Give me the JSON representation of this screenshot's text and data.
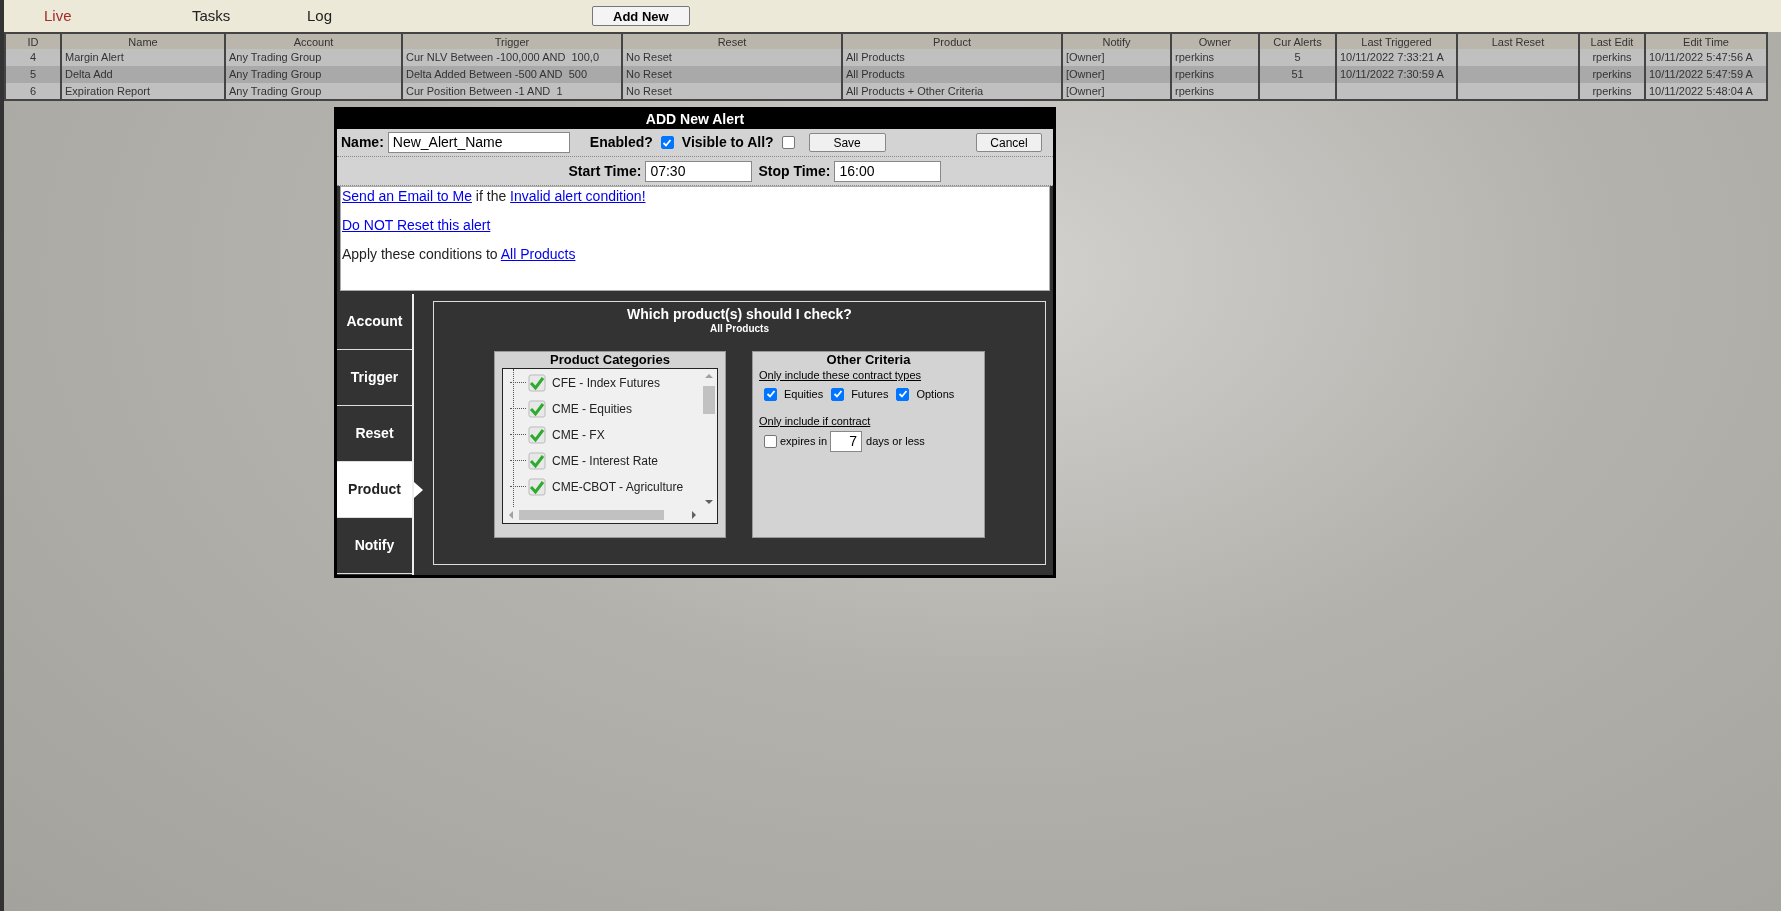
{
  "nav": {
    "tabs": [
      {
        "label": "Live",
        "selected": true
      },
      {
        "label": "Tasks",
        "selected": false
      },
      {
        "label": "Log",
        "selected": false
      }
    ],
    "add_button": "Add New"
  },
  "table": {
    "columns": [
      "ID",
      "Name",
      "Account",
      "Trigger",
      "Reset",
      "Product",
      "Notify",
      "Owner",
      "Cur Alerts",
      "Last Triggered",
      "Last Reset",
      "Last Edit",
      "Edit Time"
    ],
    "rows": [
      {
        "cells": [
          "4",
          "Margin Alert",
          "Any Trading Group",
          "Cur NLV Between -100,000 AND  100,0",
          "No Reset",
          "All Products",
          "[Owner]",
          "rperkins",
          "5",
          "10/11/2022 7:33:21 A",
          "",
          "rperkins",
          "10/11/2022 5:47:56 A"
        ]
      },
      {
        "cells": [
          "5",
          "Delta Add",
          "Any Trading Group",
          "Delta Added Between -500 AND  500",
          "No Reset",
          "All Products",
          "[Owner]",
          "rperkins",
          "51",
          "10/11/2022 7:30:59 A",
          "",
          "rperkins",
          "10/11/2022 5:47:59 A"
        ]
      },
      {
        "cells": [
          "6",
          "Expiration Report",
          "Any Trading Group",
          "Cur Position Between -1 AND  1",
          "No Reset",
          "All Products + Other Criteria",
          "[Owner]",
          "rperkins",
          "",
          "",
          "",
          "rperkins",
          "10/11/2022 5:48:04 A"
        ]
      }
    ]
  },
  "dialog": {
    "title": "ADD New Alert",
    "name_label": "Name:",
    "name_value": "New_Alert_Name",
    "enabled_label": "Enabled?",
    "enabled": true,
    "visible_label": "Visible to All?",
    "visible": false,
    "save": "Save",
    "cancel": "Cancel",
    "start_label": "Start Time:",
    "start_value": "07:30",
    "stop_label": "Stop Time:",
    "stop_value": "16:00",
    "summary": [
      {
        "parts": [
          {
            "text": "Send an Email to Me",
            "link": true
          },
          {
            "text": " if the ",
            "link": false
          },
          {
            "text": "Invalid alert condition!",
            "link": true
          }
        ]
      },
      {
        "parts": [
          {
            "text": "Do NOT Reset this alert",
            "link": true
          }
        ]
      },
      {
        "parts": [
          {
            "text": "Apply these conditions to ",
            "link": false
          },
          {
            "text": "All Products",
            "link": true
          }
        ]
      }
    ],
    "side_tabs": [
      {
        "label": "Account",
        "selected": false
      },
      {
        "label": "Trigger",
        "selected": false
      },
      {
        "label": "Reset",
        "selected": false
      },
      {
        "label": "Product",
        "selected": true
      },
      {
        "label": "Notify",
        "selected": false
      }
    ],
    "panel_title": "Which product(s) should I check?",
    "panel_subtitle": "All Products",
    "categories": {
      "title": "Product Categories",
      "items": [
        {
          "label": "CFE - Index Futures",
          "checked": true
        },
        {
          "label": "CME - Equities",
          "checked": true
        },
        {
          "label": "CME - FX",
          "checked": true
        },
        {
          "label": "CME - Interest Rate",
          "checked": true
        },
        {
          "label": "CME-CBOT - Agriculture",
          "checked": true
        }
      ]
    },
    "criteria": {
      "title": "Other Criteria",
      "types_label": "Only include these contract types",
      "types": [
        {
          "label": "Equities",
          "checked": true
        },
        {
          "label": "Futures",
          "checked": true
        },
        {
          "label": "Options",
          "checked": true
        }
      ],
      "expiry_label": "Only include if contract",
      "expiry_checked": false,
      "expiry_prefix": "expires in",
      "expiry_days": "7",
      "expiry_suffix": "days or less"
    }
  }
}
